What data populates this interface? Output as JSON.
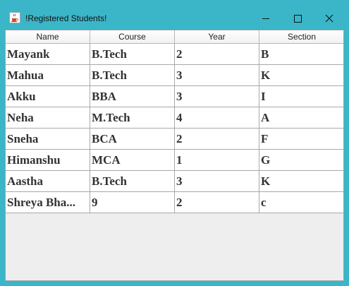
{
  "window": {
    "title": "!Registered Students!",
    "icon": "java-cup-icon"
  },
  "table": {
    "columns": [
      "Name",
      "Course",
      "Year",
      "Section"
    ],
    "rows": [
      [
        "Mayank",
        "B.Tech",
        "2",
        "B"
      ],
      [
        "Mahua",
        "B.Tech",
        "3",
        "K"
      ],
      [
        "Akku",
        "BBA",
        "3",
        "I"
      ],
      [
        "Neha",
        "M.Tech",
        "4",
        "A"
      ],
      [
        "Sneha",
        "BCA",
        "2",
        "F"
      ],
      [
        "Himanshu",
        "MCA",
        "1",
        "G"
      ],
      [
        "Aastha",
        "B.Tech",
        "3",
        "K"
      ],
      [
        "Shreya Bha...",
        "9",
        "2",
        "c"
      ]
    ]
  },
  "colors": {
    "titlebar": "#3bb6c8",
    "client_background": "#eeeeee",
    "cell_text": "#333333"
  }
}
